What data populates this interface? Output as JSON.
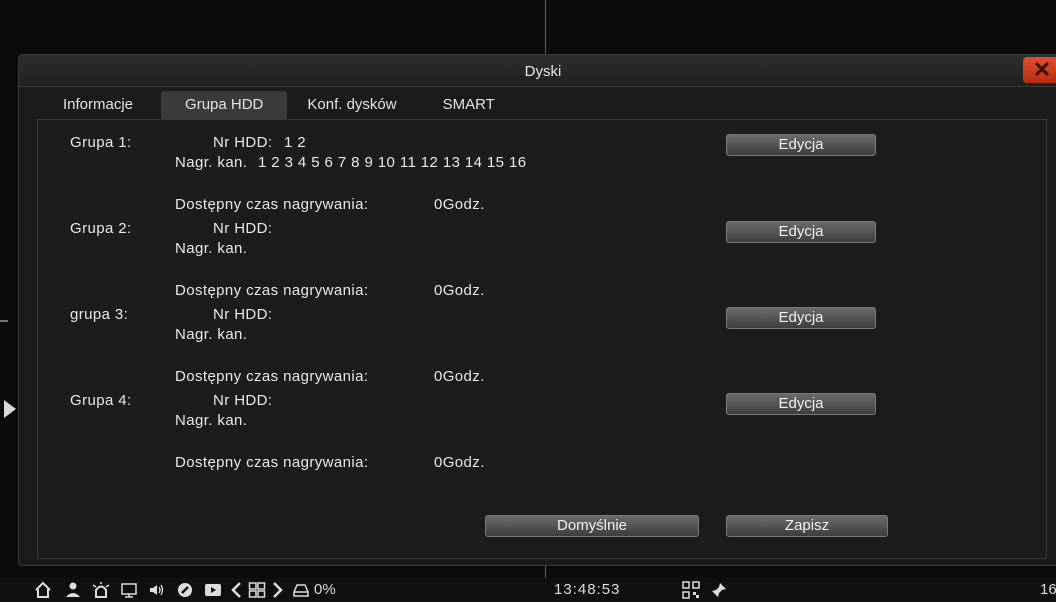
{
  "dialog": {
    "title": "Dyski",
    "close_label": "✕"
  },
  "tabs": [
    {
      "label": "Informacje"
    },
    {
      "label": "Grupa HDD"
    },
    {
      "label": "Konf. dysków"
    },
    {
      "label": "SMART"
    }
  ],
  "groups": [
    {
      "name": "Grupa 1:",
      "hdd_label": "Nr HDD:",
      "hdd_value": "1 2",
      "channels_label": "Nagr. kan.",
      "channels_value": "1 2 3 4 5 6 7 8 9 10 11 12 13 14 15 16",
      "time_label": "Dostępny czas nagrywania:",
      "time_value": "0Godz.",
      "edit_label": "Edycja"
    },
    {
      "name": "Grupa 2:",
      "hdd_label": "Nr HDD:",
      "hdd_value": "",
      "channels_label": "Nagr. kan.",
      "channels_value": "",
      "time_label": "Dostępny czas nagrywania:",
      "time_value": "0Godz.",
      "edit_label": "Edycja"
    },
    {
      "name": "grupa 3:",
      "hdd_label": "Nr HDD:",
      "hdd_value": "",
      "channels_label": "Nagr. kan.",
      "channels_value": "",
      "time_label": "Dostępny czas nagrywania:",
      "time_value": "0Godz.",
      "edit_label": "Edycja"
    },
    {
      "name": "Grupa 4:",
      "hdd_label": "Nr HDD:",
      "hdd_value": "",
      "channels_label": "Nagr. kan.",
      "channels_value": "",
      "time_label": "Dostępny czas nagrywania:",
      "time_value": "0Godz.",
      "edit_label": "Edycja"
    }
  ],
  "footer": {
    "default_label": "Domyślnie",
    "save_label": "Zapisz"
  },
  "taskbar": {
    "icons": [
      "home-icon",
      "user-icon",
      "alarm-icon",
      "monitor-icon",
      "volume-icon",
      "ptz-icon",
      "playback-icon",
      "prev-icon",
      "layout-grid-icon",
      "next-icon",
      "hdd-icon",
      "qr-code-icon",
      "pin-icon"
    ],
    "usage": "0%",
    "time": "13:48:53",
    "channel_count": "16"
  }
}
